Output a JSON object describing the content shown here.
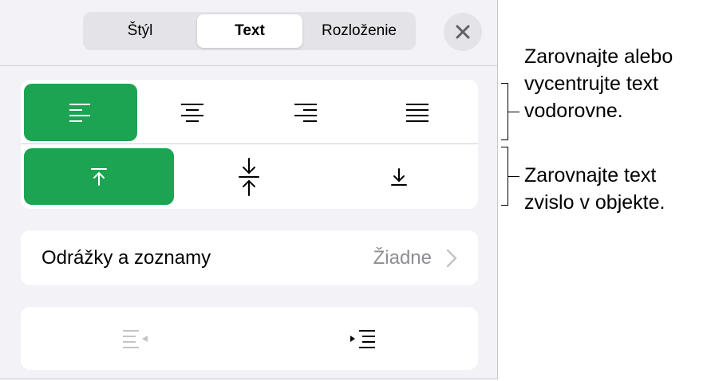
{
  "tabs": [
    {
      "label": "Štýl",
      "active": false
    },
    {
      "label": "Text",
      "active": true
    },
    {
      "label": "Rozloženie",
      "active": false
    }
  ],
  "close_icon": "close-icon",
  "horizontal_alignment": {
    "options": [
      "align-left-icon",
      "align-center-icon",
      "align-right-icon",
      "justify-icon"
    ],
    "selected": "align-left-icon"
  },
  "vertical_alignment": {
    "options": [
      "align-top-icon",
      "align-middle-icon",
      "align-bottom-icon"
    ],
    "selected": "align-top-icon"
  },
  "bullets": {
    "label": "Odrážky a zoznamy",
    "value": "Žiadne"
  },
  "indent": {
    "options": [
      "decrease-indent-icon",
      "increase-indent-icon"
    ]
  },
  "annotations": {
    "horizontal": [
      "Zarovnajte alebo",
      "vycentrujte text",
      "vodorovne."
    ],
    "vertical": [
      "Zarovnajte text",
      "zvislo v objekte."
    ]
  },
  "colors": {
    "accent": "#1da453",
    "panel": "#f2f2f7",
    "secondary_text": "#8e8e93"
  }
}
